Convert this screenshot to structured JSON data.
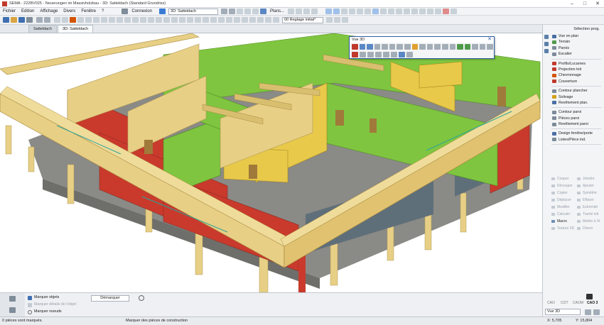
{
  "window": {
    "title": "SEMA  -  222BV025  -  Neuerungen im Massivholzbau  -  3D: Satteldach (Standard Grundriss)",
    "controls": [
      "–",
      "□",
      "✕"
    ]
  },
  "menu": {
    "items": [
      "Fichier",
      "Edition",
      "Affichage",
      "Divers",
      "Fenêtre",
      "?"
    ],
    "connexion_label": "Connexion",
    "view_selector": "3D: Satteldach",
    "plans_label": "Plans..."
  },
  "toolbar": {
    "reglage_value": "00 Reglage initial*"
  },
  "tabs": [
    {
      "label": "Satteldach"
    },
    {
      "label": "3D: Satteldach"
    }
  ],
  "floating_window": {
    "title": "Vue 3D",
    "close": "✕"
  },
  "right_panel": {
    "header": "Sélection prog.",
    "groups": [
      [
        {
          "label": "Vue en plan",
          "icon": "floor-plan-icon",
          "color": "#4a6fa5"
        },
        {
          "label": "Terrain",
          "icon": "terrain-icon",
          "color": "#4f9a4a"
        },
        {
          "label": "Parois",
          "icon": "wall-icon",
          "color": "#7c8a99"
        },
        {
          "label": "Escalier",
          "icon": "stairs-icon",
          "color": "#7c8a99"
        }
      ],
      [
        {
          "label": "Profils/Lucarnes",
          "icon": "dormer-icon",
          "color": "#c0392b"
        },
        {
          "label": "Projection toit",
          "icon": "roof-projection-icon",
          "color": "#c0392b"
        },
        {
          "label": "Chevronnage",
          "icon": "rafter-icon",
          "color": "#d35400"
        },
        {
          "label": "Couverture",
          "icon": "roofing-icon",
          "color": "#c0392b"
        }
      ],
      [
        {
          "label": "Contour plancher",
          "icon": "floor-outline-icon",
          "color": "#7c8a99"
        },
        {
          "label": "Solivage",
          "icon": "joist-icon",
          "color": "#d4a017"
        },
        {
          "label": "Revêtement plan.",
          "icon": "floor-covering-icon",
          "color": "#4a6fa5"
        }
      ],
      [
        {
          "label": "Contour paroi",
          "icon": "wall-outline-icon",
          "color": "#7c8a99"
        },
        {
          "label": "Pièces paroi",
          "icon": "wall-parts-icon",
          "color": "#7c8a99"
        },
        {
          "label": "Revêtement paroi",
          "icon": "wall-covering-icon",
          "color": "#7c8a99"
        }
      ],
      [
        {
          "label": "Design fenêtre/porte",
          "icon": "window-design-icon",
          "color": "#4a6fa5"
        },
        {
          "label": "Listes/Pièce ind.",
          "icon": "list-icon",
          "color": "#7c8a99"
        }
      ]
    ],
    "edit_tools": [
      [
        "Couper",
        "Joindre"
      ],
      [
        "Découper",
        "Ajouter"
      ],
      [
        "Copier",
        "Symétrie"
      ],
      [
        "Déplacer",
        "Effacer"
      ],
      [
        "Modifier",
        "Extrémité"
      ],
      [
        "Calculer",
        "Tramé toit"
      ],
      [
        "Macro",
        "Mettre à l'é"
      ],
      [
        "Texture 3D",
        "Divers"
      ]
    ],
    "edit_tools_active": [
      "Macro"
    ]
  },
  "bottom_panel": {
    "options": [
      {
        "label": "Marquer objets",
        "enabled": true
      },
      {
        "label": "Marquer détails de l'objet",
        "enabled": false
      },
      {
        "label": "Marquer noeuds",
        "enabled": true
      }
    ],
    "demarquer_label": "Démarquer",
    "cao_tabs": [
      "CAO",
      "COT",
      "CAOM",
      "CAO 3"
    ],
    "cao_active": "CAO 3",
    "view_select": "Vue 3D"
  },
  "status": {
    "left": "0 pièces sont marqués.",
    "mid": "Marquer des pièces de construction",
    "x": "X: 5,705",
    "y": "Y: 15,804"
  },
  "colors": {
    "wall_red": "#c93a2c",
    "wall_green": "#7fc540",
    "wall_yellow": "#e8c94a",
    "timber": "#e7cf85",
    "floor_slab": "#8a8a86",
    "accent": "#2f5f9e"
  }
}
